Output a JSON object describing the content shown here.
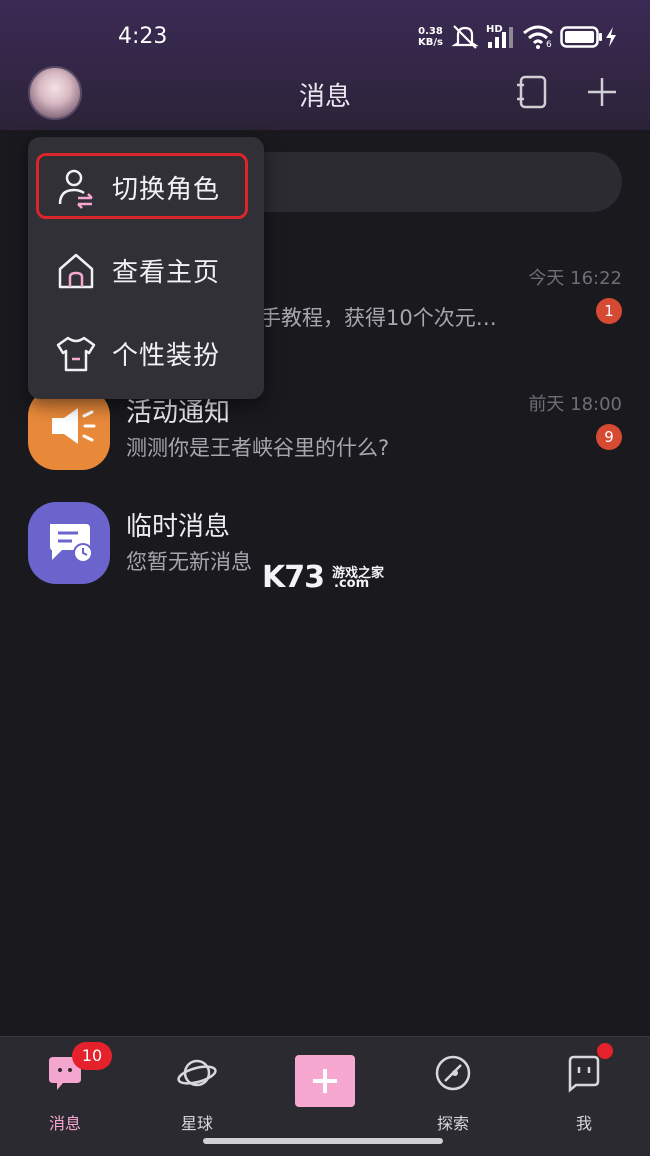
{
  "status_bar": {
    "time": "4:23",
    "net_speed_value": "0.38",
    "net_speed_unit": "KB/s",
    "hd_label": "HD",
    "wifi_label": "6",
    "icons": [
      "mute-bell-icon",
      "signal-icon",
      "wifi-icon",
      "battery-icon",
      "charging-icon"
    ]
  },
  "header": {
    "title": "消息",
    "left_icon": "avatar",
    "right_icons": [
      "contacts-book-icon",
      "plus-icon"
    ]
  },
  "popup_menu": {
    "items": [
      {
        "label": "切换角色",
        "icon": "switch-role-icon",
        "highlighted": true
      },
      {
        "label": "查看主页",
        "icon": "home-icon",
        "highlighted": false
      },
      {
        "label": "个性装扮",
        "icon": "tshirt-icon",
        "highlighted": false
      }
    ]
  },
  "conversations": [
    {
      "name": "",
      "preview": "手教程，获得10个次元…",
      "time": "今天 16:22",
      "badge": "1",
      "icon": "hidden-icon"
    },
    {
      "name": "活动通知",
      "preview": "测测你是王者峡谷里的什么?",
      "time": "前天 18:00",
      "badge": "9",
      "icon": "megaphone-icon",
      "color": "#e8893a"
    },
    {
      "name": "临时消息",
      "preview": "您暂无新消息",
      "time": "",
      "badge": "",
      "icon": "temp-message-icon",
      "color": "#6a64cc"
    }
  ],
  "watermark": {
    "brand": "K73",
    "cn": "游戏之家",
    "domain": ".com"
  },
  "tabbar": {
    "tabs": [
      {
        "label": "消息",
        "icon": "message-icon",
        "active": true
      },
      {
        "label": "星球",
        "icon": "planet-icon",
        "active": false
      },
      {
        "label": "",
        "icon": "plus-icon",
        "active": false
      },
      {
        "label": "探索",
        "icon": "explore-icon",
        "active": false
      },
      {
        "label": "我",
        "icon": "me-icon",
        "active": false
      }
    ],
    "message_badge": "10",
    "me_dot": true
  },
  "colors": {
    "accent_pink": "#f7a8d0",
    "badge_red": "#e5212b",
    "header_purple": "#3b2a55"
  }
}
